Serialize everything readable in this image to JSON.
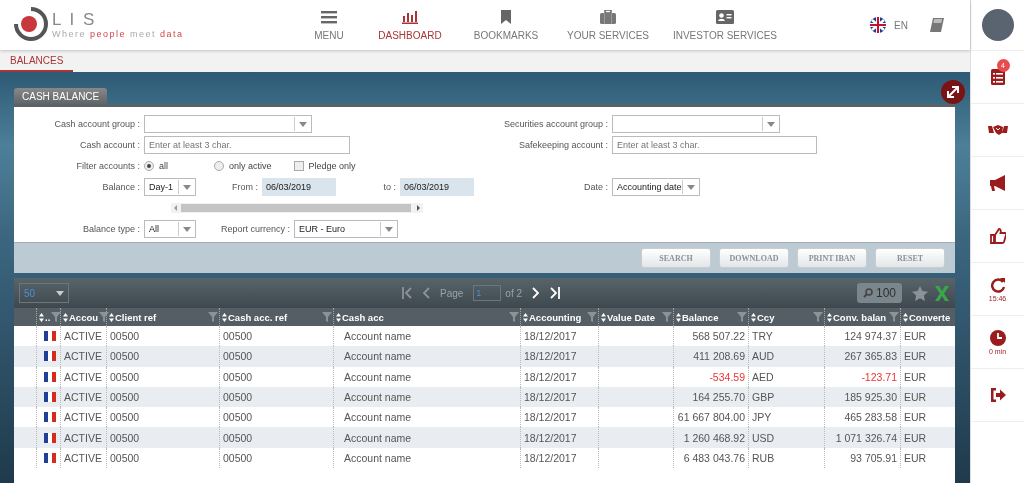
{
  "logo": {
    "name": "L I S",
    "tagline": [
      {
        "text": "Where",
        "accent": false
      },
      {
        "text": "people",
        "accent": true
      },
      {
        "text": "meet",
        "accent": false
      },
      {
        "text": "data",
        "accent": true
      }
    ]
  },
  "nav": [
    {
      "label": "MENU",
      "selected": false
    },
    {
      "label": "DASHBOARD",
      "selected": true
    },
    {
      "label": "BOOKMARKS",
      "selected": false
    },
    {
      "label": "YOUR SERVICES",
      "selected": false
    },
    {
      "label": "INVESTOR SERVICES",
      "selected": false
    }
  ],
  "language": "EN",
  "tabs": [
    {
      "label": "BALANCES",
      "selected": true
    }
  ],
  "panel": {
    "title": "CASH BALANCE",
    "left": [
      [
        {
          "kind": "select",
          "label": "Cash account group :"
        }
      ],
      [
        {
          "kind": "input",
          "label": "Cash account :",
          "placeholder": "Enter at least 3 char."
        }
      ],
      [
        {
          "kind": "radio",
          "label": "Filter accounts :",
          "text": "all",
          "selected": true
        },
        {
          "kind": "radio",
          "text": "only active",
          "selected": false
        },
        {
          "kind": "checkbox",
          "text": "Pledge only",
          "checked": false
        }
      ],
      [
        {
          "kind": "select",
          "label": "Balance :",
          "value": "Day-1"
        },
        {
          "kind": "date",
          "label": "From :",
          "value": "06/03/2019"
        },
        {
          "kind": "date",
          "label": "to :",
          "value": "06/03/2019"
        }
      ],
      [
        {
          "kind": "scrollbar"
        }
      ],
      [
        {
          "kind": "select",
          "label": "Balance type :",
          "value": "All"
        },
        {
          "kind": "select",
          "label": "Report currency :",
          "value": "EUR - Euro"
        }
      ]
    ],
    "right": [
      [
        {
          "kind": "select",
          "label": "Securities account group :"
        }
      ],
      [
        {
          "kind": "input",
          "label": "Safekeeping account :",
          "placeholder": "Enter at least 3 char."
        }
      ],
      [
        {
          "kind": "select",
          "label": "Date :",
          "value": "Accounting date"
        }
      ]
    ],
    "buttons": [
      "SEARCH",
      "DOWNLOAD",
      "PRINT IBAN",
      "RESET"
    ]
  },
  "grid": {
    "page_size": "50",
    "page_label": "Page",
    "page": "1",
    "page_of": "of 2",
    "search_count": "100",
    "columns": [
      {
        "label": ".."
      },
      {
        "label": "Accou"
      },
      {
        "label": "Client ref"
      },
      {
        "label": "Cash acc. ref"
      },
      {
        "label": "Cash acc"
      },
      {
        "label": "Accounting"
      },
      {
        "label": "Value Date"
      },
      {
        "label": "Balance"
      },
      {
        "label": "Ccy"
      },
      {
        "label": "Conv. balan"
      },
      {
        "label": "Converte"
      }
    ],
    "rows": [
      {
        "status": "ACTIVE",
        "client_ref": "00500",
        "cash_acc_ref": "00500",
        "cash_acc": "Account name",
        "accounting": "18/12/2017",
        "balance": "568 507.22",
        "ccy": "TRY",
        "conv_balance": "124 974.37",
        "converted": "EUR",
        "negative": false
      },
      {
        "status": "ACTIVE",
        "client_ref": "00500",
        "cash_acc_ref": "00500",
        "cash_acc": "Account name",
        "accounting": "18/12/2017",
        "balance": "411 208.69",
        "ccy": "AUD",
        "conv_balance": "267 365.83",
        "converted": "EUR",
        "negative": false
      },
      {
        "status": "ACTIVE",
        "client_ref": "00500",
        "cash_acc_ref": "00500",
        "cash_acc": "Account name",
        "accounting": "18/12/2017",
        "balance": "-534.59",
        "ccy": "AED",
        "conv_balance": "-123.71",
        "converted": "EUR",
        "negative": true
      },
      {
        "status": "ACTIVE",
        "client_ref": "00500",
        "cash_acc_ref": "00500",
        "cash_acc": "Account name",
        "accounting": "18/12/2017",
        "balance": "164 255.70",
        "ccy": "GBP",
        "conv_balance": "185 925.30",
        "converted": "EUR",
        "negative": false
      },
      {
        "status": "ACTIVE",
        "client_ref": "00500",
        "cash_acc_ref": "00500",
        "cash_acc": "Account name",
        "accounting": "18/12/2017",
        "balance": "61 667 804.00",
        "ccy": "JPY",
        "conv_balance": "465 283.58",
        "converted": "EUR",
        "negative": false
      },
      {
        "status": "ACTIVE",
        "client_ref": "00500",
        "cash_acc_ref": "00500",
        "cash_acc": "Account name",
        "accounting": "18/12/2017",
        "balance": "1 260 468.92",
        "ccy": "USD",
        "conv_balance": "1 071 326.74",
        "converted": "EUR",
        "negative": false
      },
      {
        "status": "ACTIVE",
        "client_ref": "00500",
        "cash_acc_ref": "00500",
        "cash_acc": "Account name",
        "accounting": "18/12/2017",
        "balance": "6 483 043.76",
        "ccy": "RUB",
        "conv_balance": "93 705.91",
        "converted": "EUR",
        "negative": false
      }
    ]
  },
  "sidebar": {
    "badge": "4",
    "refresh_time": "15:46",
    "idle_time": "0 min"
  }
}
